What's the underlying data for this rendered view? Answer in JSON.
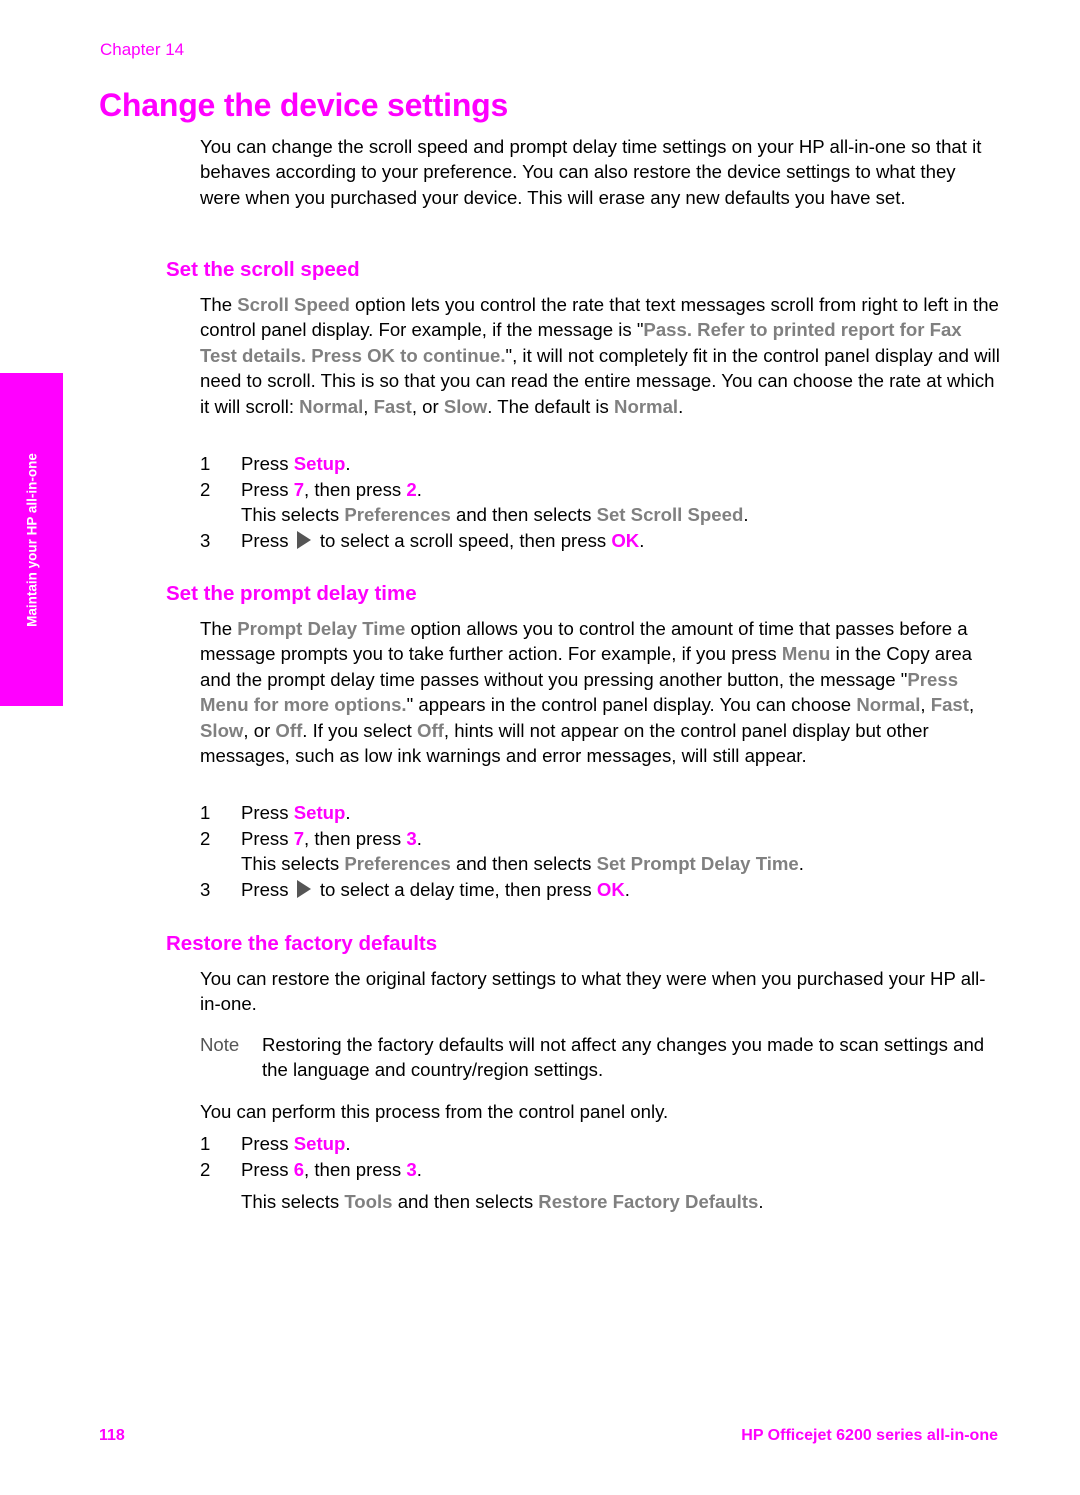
{
  "header": {
    "chapter": "Chapter 14",
    "title": "Change the device settings"
  },
  "side_tab": {
    "label_part1": "Maintain your HP ",
    "label_part2": "all-in-one"
  },
  "intro": {
    "text": "You can change the scroll speed and prompt delay time settings on your HP all-in-one so that it behaves according to your preference. You can also restore the device settings to what they were when you purchased your device. This will erase any new defaults you have set."
  },
  "scroll_speed": {
    "heading": "Set the scroll speed",
    "p_the": "The ",
    "p_option": "Scroll Speed",
    "p_mid1": " option lets you control the rate that text messages scroll from right to left in the control panel display. For example, if the message is \"",
    "p_message": "Pass. Refer to printed report for Fax Test details. Press OK to continue.",
    "p_mid2": "\", it will not completely fit in the control panel display and will need to scroll. This is so that you can read the entire message. You can choose the rate at which it will scroll: ",
    "p_normal": "Normal",
    "p_comma": ", ",
    "p_fast": "Fast",
    "p_or": ", or ",
    "p_slow": "Slow",
    "p_default": ". The default is ",
    "p_default_val": "Normal",
    "p_end": ".",
    "steps": [
      {
        "num": "1",
        "pre": "Press ",
        "key": "Setup",
        "post": "."
      },
      {
        "num": "2",
        "pre": "Press ",
        "key": "7",
        "mid": ", then press ",
        "key2": "2",
        "post": "."
      },
      {
        "num": "3",
        "pre": "Press ",
        "icon": "right-arrow-icon",
        "mid": " to select a scroll speed, then press ",
        "key": "OK",
        "post": "."
      }
    ],
    "sub": {
      "pre": "This selects ",
      "a": "Preferences",
      "mid": " and then selects ",
      "b": "Set Scroll Speed",
      "post": "."
    }
  },
  "prompt_delay": {
    "heading": "Set the prompt delay time",
    "p_the": "The ",
    "p_option": "Prompt Delay Time",
    "p_mid1": " option allows you to control the amount of time that passes before a message prompts you to take further action. For example, if you press ",
    "p_menu": "Menu",
    "p_mid2": " in the Copy area and the prompt delay time passes without you pressing another button, the message \"",
    "p_message": "Press Menu for more options.",
    "p_mid3": "\" appears in the control panel display. You can choose ",
    "p_normal": "Normal",
    "p_c1": ", ",
    "p_fast": "Fast",
    "p_c2": ", ",
    "p_slow": "Slow",
    "p_or": ", or ",
    "p_off": "Off",
    "p_mid4": ". If you select ",
    "p_off2": "Off",
    "p_end": ", hints will not appear on the control panel display but other messages, such as low ink warnings and error messages, will still appear.",
    "steps": [
      {
        "num": "1",
        "pre": "Press ",
        "key": "Setup",
        "post": "."
      },
      {
        "num": "2",
        "pre": "Press ",
        "key": "7",
        "mid": ", then press ",
        "key2": "3",
        "post": "."
      },
      {
        "num": "3",
        "pre": "Press ",
        "icon": "right-arrow-icon",
        "mid": " to select a delay time, then press ",
        "key": "OK",
        "post": "."
      }
    ],
    "sub": {
      "pre": "This selects ",
      "a": "Preferences",
      "mid": " and then selects ",
      "b": "Set Prompt Delay Time",
      "post": "."
    }
  },
  "factory": {
    "heading": "Restore the factory defaults",
    "intro": "You can restore the original factory settings to what they were when you purchased your HP all-in-one.",
    "note_label": "Note",
    "note_text": "Restoring the factory defaults will not affect any changes you made to scan settings and the language and country/region settings.",
    "control_panel_only": "You can perform this process from the control panel only.",
    "steps": [
      {
        "num": "1",
        "pre": "Press ",
        "key": "Setup",
        "post": "."
      },
      {
        "num": "2",
        "pre": "Press ",
        "key": "6",
        "mid": ", then press ",
        "key2": "3",
        "post": "."
      }
    ],
    "sub": {
      "pre": "This selects ",
      "a": "Tools",
      "mid": " and then selects ",
      "b": "Restore Factory Defaults",
      "post": "."
    }
  },
  "footer": {
    "page_number": "118",
    "product_name": "HP Officejet 6200 series all-in-one"
  },
  "colors": {
    "accent": "#ff00ff",
    "emphasis_gray": "#808080",
    "note_gray": "#555555"
  }
}
